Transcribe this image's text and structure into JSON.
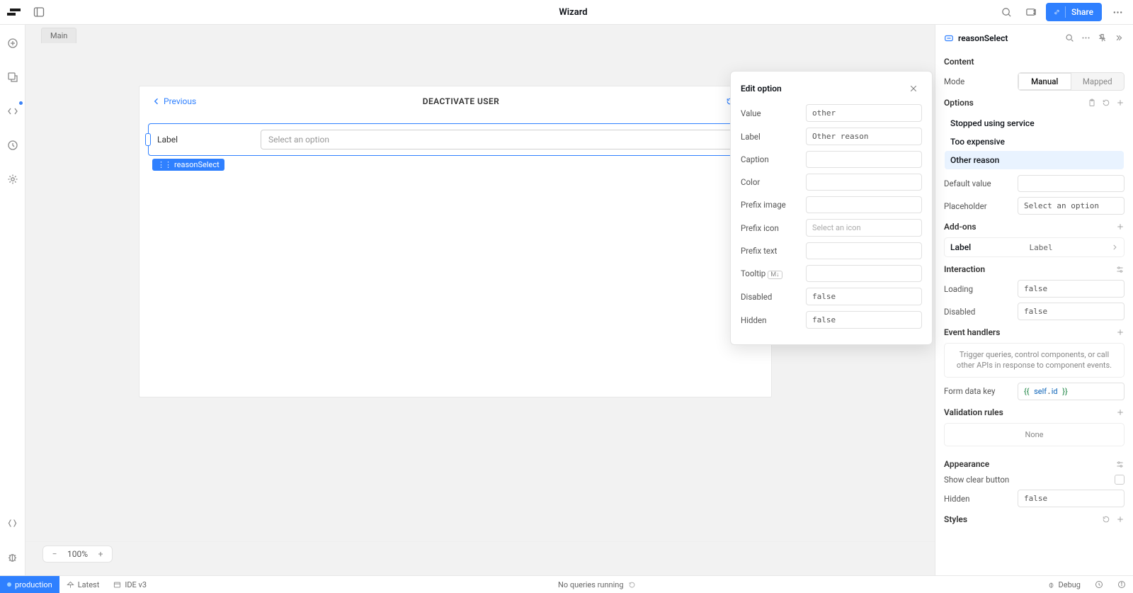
{
  "topbar": {
    "title": "Wizard",
    "share_label": "Share"
  },
  "tabstrip": {
    "main_tab": "Main"
  },
  "canvas": {
    "previous_label": "Previous",
    "frame_title": "DEACTIVATE USER",
    "reset_label": "Reset",
    "select_label": "Label",
    "select_placeholder": "Select an option",
    "component_badge": "reasonSelect",
    "zoom_level": "100%"
  },
  "popover": {
    "title": "Edit option",
    "fields": {
      "value_label": "Value",
      "value": "other",
      "label_label": "Label",
      "label": "Other reason",
      "caption_label": "Caption",
      "caption": "",
      "color_label": "Color",
      "color": "",
      "prefix_image_label": "Prefix image",
      "prefix_image": "",
      "prefix_icon_label": "Prefix icon",
      "prefix_icon_placeholder": "Select an icon",
      "prefix_text_label": "Prefix text",
      "prefix_text": "",
      "tooltip_label": "Tooltip",
      "tooltip": "",
      "disabled_label": "Disabled",
      "disabled": "false",
      "hidden_label": "Hidden",
      "hidden": "false"
    }
  },
  "inspector": {
    "component_name": "reasonSelect",
    "content_title": "Content",
    "mode_label": "Mode",
    "mode_manual": "Manual",
    "mode_mapped": "Mapped",
    "options_title": "Options",
    "options": [
      "Stopped using service",
      "Too expensive",
      "Other reason"
    ],
    "selected_option_index": 2,
    "default_value_label": "Default value",
    "default_value": "",
    "placeholder_label": "Placeholder",
    "placeholder_value": "Select an option",
    "addons_title": "Add-ons",
    "addon_label_name": "Label",
    "addon_label_value": "Label",
    "interaction_title": "Interaction",
    "loading_label": "Loading",
    "loading_value": "false",
    "disabled_label": "Disabled",
    "disabled_value": "false",
    "event_handlers_title": "Event handlers",
    "event_handlers_hint": "Trigger queries, control components, or call other APIs in response to component events.",
    "form_data_key_label": "Form data key",
    "form_data_key_value": "{{ self.id }}",
    "validation_title": "Validation rules",
    "validation_none": "None",
    "appearance_title": "Appearance",
    "show_clear_label": "Show clear button",
    "hidden_label": "Hidden",
    "hidden_value": "false",
    "styles_title": "Styles"
  },
  "statusbar": {
    "env": "production",
    "latest": "Latest",
    "ide": "IDE v3",
    "queries": "No queries running",
    "debug": "Debug"
  }
}
